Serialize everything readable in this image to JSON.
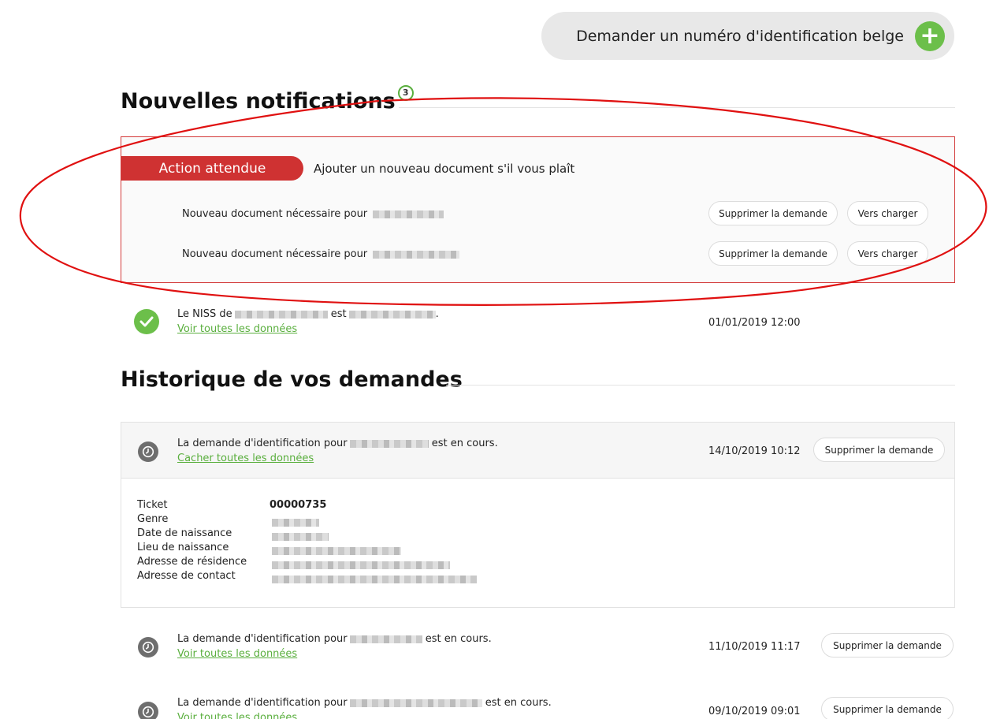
{
  "header": {
    "request_button_label": "Demander un numéro d'identification belge"
  },
  "notifications": {
    "title": "Nouvelles notifications",
    "count": "3",
    "action_tag": "Action attendue",
    "action_text": "Ajouter un nouveau document s'il vous plaît",
    "doc_rows": [
      {
        "text": "Nouveau document nécessaire pour",
        "delete_label": "Supprimer la demande",
        "upload_label": "Vers charger"
      },
      {
        "text": "Nouveau document nécessaire pour",
        "delete_label": "Supprimer la demande",
        "upload_label": "Vers charger"
      }
    ],
    "niss": {
      "prefix": "Le NISS de",
      "middle": "est",
      "suffix": ".",
      "link": "Voir toutes les données",
      "date": "01/01/2019 12:00"
    }
  },
  "history": {
    "title": "Historique de vos demandes",
    "items": [
      {
        "prefix": "La demande d'identification pour",
        "suffix": "est en cours.",
        "link": "Cacher toutes les données",
        "date": "14/10/2019 10:12",
        "delete_label": "Supprimer la demande"
      },
      {
        "prefix": "La demande d'identification pour",
        "suffix": "est en cours.",
        "link": "Voir toutes les données",
        "date": "11/10/2019 11:17",
        "delete_label": "Supprimer la demande"
      },
      {
        "prefix": "La demande d'identification pour",
        "suffix": "est en cours.",
        "link": "Voir toutes les données",
        "date": "09/10/2019 09:01",
        "delete_label": "Supprimer la demande"
      }
    ],
    "details": {
      "ticket_label": "Ticket",
      "ticket_value": "00000735",
      "genre_label": "Genre",
      "birth_date_label": "Date de naissance",
      "birth_place_label": "Lieu de naissance",
      "residence_label": "Adresse de résidence",
      "contact_label": "Adresse de contact"
    }
  },
  "icons": {
    "add": "plus-circle-icon",
    "success": "check-circle-icon",
    "pending": "clock-icon"
  },
  "colors": {
    "accent_green": "#6cbf4a",
    "alert_red": "#cf3232",
    "annotation_red": "#e01010",
    "pending_gray": "#6e6e6e"
  }
}
